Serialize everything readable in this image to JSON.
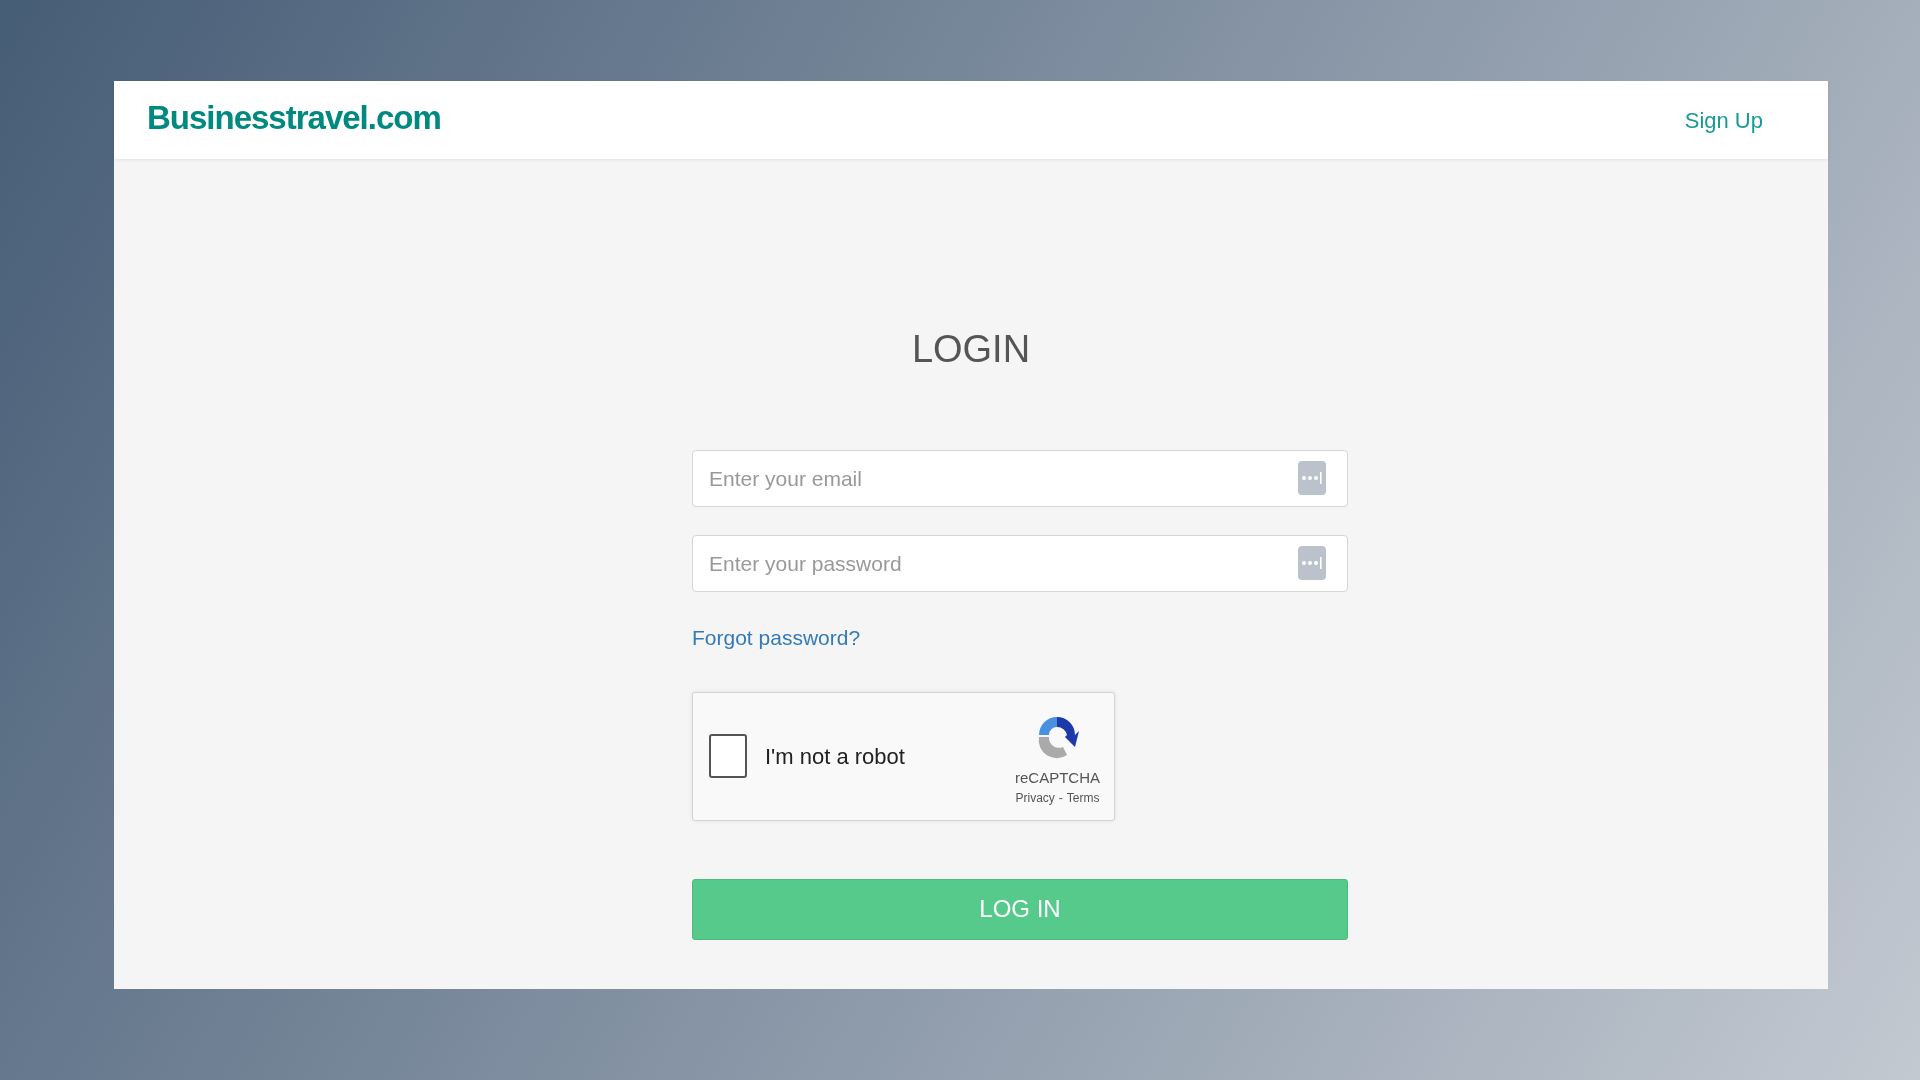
{
  "header": {
    "logo": "Businesstravel.com",
    "sign_up": "Sign Up"
  },
  "login": {
    "title": "LOGIN",
    "fields": [
      {
        "placeholder": "Enter your email"
      },
      {
        "placeholder": "Enter your password"
      }
    ],
    "forgot_password": "Forgot password?",
    "captcha": {
      "label": "I'm not a robot",
      "checked": false,
      "brand": "reCAPTCHA",
      "privacy": "Privacy",
      "separator": "-",
      "terms": "Terms"
    },
    "submit": "LOG IN"
  }
}
